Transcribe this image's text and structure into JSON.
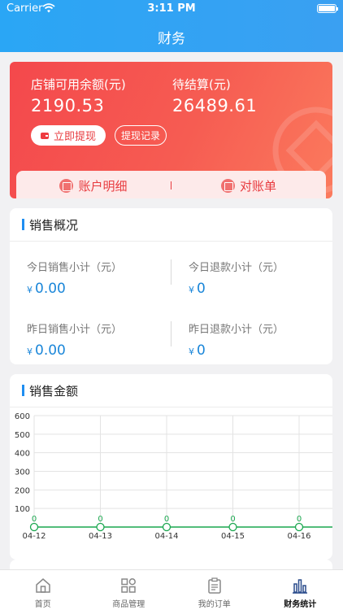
{
  "status_bar": {
    "carrier": "Carrier",
    "time": "3:11 PM"
  },
  "header": {
    "title": "财务"
  },
  "balance": {
    "available_label": "店铺可用余额(元)",
    "available_value": "2190.53",
    "pending_label": "待结算(元)",
    "pending_value": "26489.61",
    "withdraw_label": "立即提现",
    "records_label": "提现记录"
  },
  "tabs": [
    {
      "label": "账户明细",
      "icon": "ledger-icon"
    },
    {
      "label": "对账单",
      "icon": "statement-icon"
    }
  ],
  "sales_overview": {
    "title": "销售概况",
    "currency": "¥",
    "today_sales_label": "今日销售小计（元）",
    "today_sales_value": "0.00",
    "today_refund_label": "今日退款小计（元）",
    "today_refund_value": "0",
    "yesterday_sales_label": "昨日销售小计（元）",
    "yesterday_sales_value": "0.00",
    "yesterday_refund_label": "昨日退款小计（元）",
    "yesterday_refund_value": "0"
  },
  "sales_amount": {
    "title": "销售金额"
  },
  "chart_data": {
    "type": "line",
    "categories": [
      "04-12",
      "04-13",
      "04-14",
      "04-15",
      "04-16"
    ],
    "values": [
      0,
      0,
      0,
      0,
      0
    ],
    "y_ticks": [
      "600",
      "500",
      "400",
      "300",
      "200",
      "100"
    ],
    "ylim": [
      0,
      600
    ],
    "grid": true,
    "series_color": "#1aa74f"
  },
  "bottom_nav": [
    {
      "label": "首页",
      "icon": "home-icon",
      "active": false
    },
    {
      "label": "商品管理",
      "icon": "grid-icon",
      "active": false
    },
    {
      "label": "我的订单",
      "icon": "clipboard-icon",
      "active": false
    },
    {
      "label": "财务统计",
      "icon": "bar-chart-icon",
      "active": true
    }
  ],
  "colors": {
    "header": "#2aa6f5",
    "card_red": "#f4484c",
    "accent_blue": "#1f8ef1"
  }
}
